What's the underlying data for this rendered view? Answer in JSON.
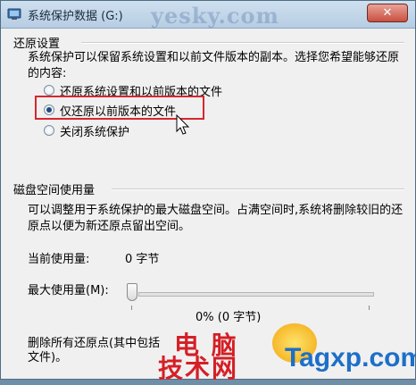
{
  "window": {
    "title": "系统保护数据 (G:)",
    "watermark_top": "yesky.com",
    "close_glyph": "✕"
  },
  "restore": {
    "group_title": "还原设置",
    "description": "系统保护可以保留系统设置和以前文件版本的副本。选择您希望能够还原的内容:",
    "options": [
      {
        "label": "还原系统设置和以前版本的文件",
        "selected": false
      },
      {
        "label": "仅还原以前版本的文件",
        "selected": true
      },
      {
        "label": "关闭系统保护",
        "selected": false
      }
    ]
  },
  "disk": {
    "group_title": "磁盘空间使用量",
    "description": "可以调整用于系统保护的最大磁盘空间。占满空间时,系统将删除较旧的还原点以便为新还原点留出空间。",
    "current_label": "当前使用量:",
    "current_value": "0 字节",
    "max_label": "最大使用量(M):",
    "slider_value": 0,
    "slider_readout": "0% (0 字节)",
    "delete_text_line1": "删除所有还原点(其中包括",
    "delete_text_line2": "文件)。"
  },
  "watermark": {
    "cn_line1": "电 脑",
    "cn_line2": "技术网",
    "en": "Tagxp.com"
  },
  "colors": {
    "highlight": "#d8262d",
    "radio_dot": "#1f4a80"
  }
}
